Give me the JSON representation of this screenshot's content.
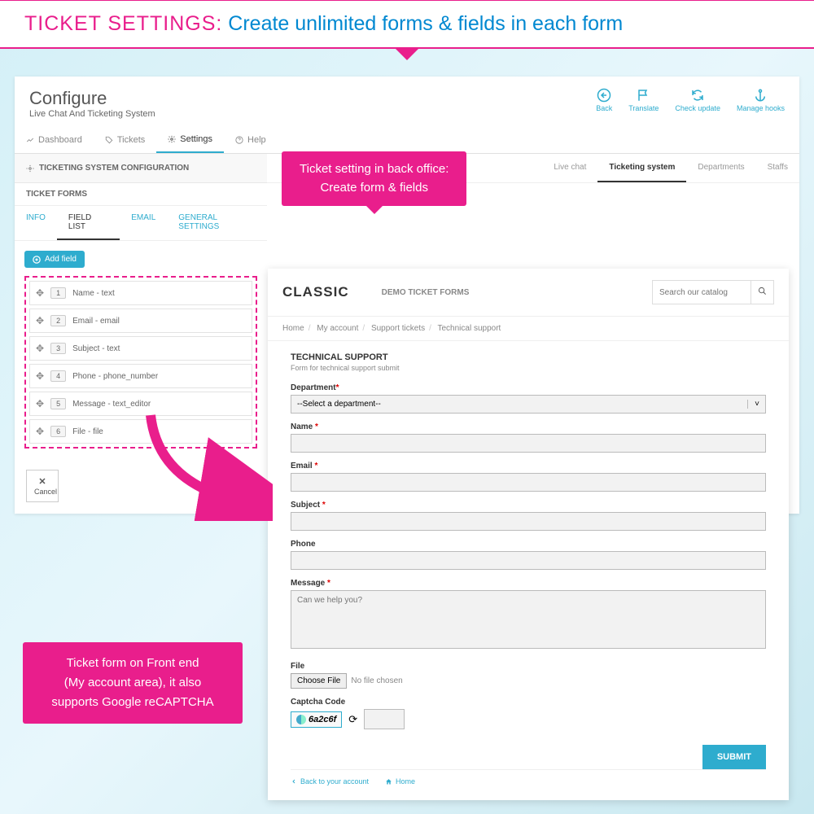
{
  "banner": {
    "label": "TICKET SETTINGS:",
    "text": "Create unlimited forms & fields in each form"
  },
  "admin": {
    "title": "Configure",
    "subtitle": "Live Chat And Ticketing System",
    "toolbar": {
      "back": "Back",
      "translate": "Translate",
      "check": "Check update",
      "hooks": "Manage hooks"
    },
    "tabs": {
      "dashboard": "Dashboard",
      "tickets": "Tickets",
      "settings": "Settings",
      "help": "Help"
    },
    "configTitle": "TICKETING SYSTEM CONFIGURATION",
    "formsLabel": "TICKET FORMS",
    "subTabs": {
      "info": "INFO",
      "fieldList": "FIELD LIST",
      "email": "EMAIL",
      "general": "GENERAL SETTINGS"
    },
    "addField": "Add field",
    "fields": [
      {
        "n": "1",
        "label": "Name - text"
      },
      {
        "n": "2",
        "label": "Email - email"
      },
      {
        "n": "3",
        "label": "Subject - text"
      },
      {
        "n": "4",
        "label": "Phone - phone_number"
      },
      {
        "n": "5",
        "label": "Message - text_editor"
      },
      {
        "n": "6",
        "label": "File - file"
      }
    ],
    "cancel": "Cancel",
    "rightTabs": {
      "live": "Live chat",
      "ticketing": "Ticketing system",
      "dept": "Departments",
      "staffs": "Staffs"
    }
  },
  "callout1": {
    "line1": "Ticket setting in back office:",
    "line2": "Create form & fields"
  },
  "callout2": {
    "line1": "Ticket form on Front end",
    "line2": "(My account area), it also",
    "line3": "supports Google reCAPTCHA"
  },
  "frontend": {
    "logo": "CLASSIC",
    "demo": "DEMO TICKET FORMS",
    "searchPlaceholder": "Search our catalog",
    "breadcrumb": {
      "home": "Home",
      "account": "My account",
      "tickets": "Support tickets",
      "current": "Technical support"
    },
    "formTitle": "TECHNICAL SUPPORT",
    "formSub": "Form for technical support submit",
    "labels": {
      "department": "Department",
      "deptPlaceholder": "--Select a department--",
      "name": "Name",
      "email": "Email",
      "subject": "Subject",
      "phone": "Phone",
      "message": "Message",
      "messagePlaceholder": "Can we help you?",
      "file": "File",
      "chooseFile": "Choose File",
      "noFile": "No file chosen",
      "captcha": "Captcha Code",
      "captchaText": "6a2c6f"
    },
    "submit": "SUBMIT",
    "footer": {
      "back": "Back to your account",
      "home": "Home"
    }
  }
}
